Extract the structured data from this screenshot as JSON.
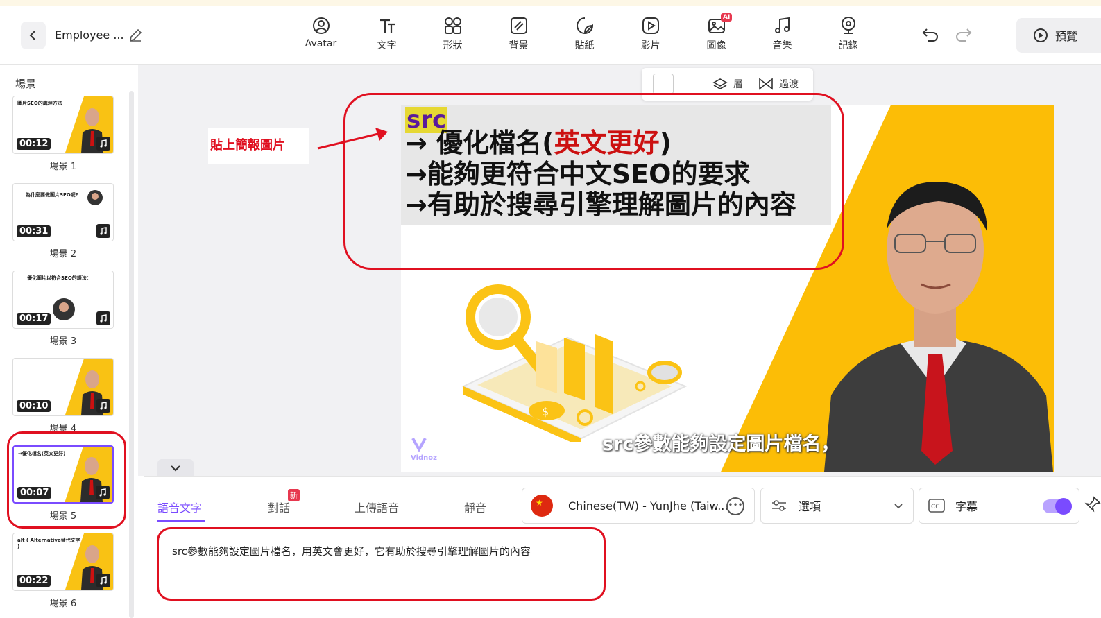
{
  "header": {
    "title": "Employee ...",
    "tools": [
      {
        "label": "Avatar",
        "icon": "avatar-icon"
      },
      {
        "label": "文字",
        "icon": "text-icon"
      },
      {
        "label": "形狀",
        "icon": "shapes-icon"
      },
      {
        "label": "背景",
        "icon": "background-icon"
      },
      {
        "label": "貼紙",
        "icon": "sticker-icon"
      },
      {
        "label": "影片",
        "icon": "video-icon"
      },
      {
        "label": "圖像",
        "icon": "image-icon",
        "badge": "AI"
      },
      {
        "label": "音樂",
        "icon": "music-icon"
      },
      {
        "label": "記錄",
        "icon": "record-icon"
      }
    ],
    "preview_label": "預覽"
  },
  "sidebar": {
    "title": "場景",
    "scenes": [
      {
        "label": "場景 1",
        "time": "00:12",
        "thumb_text": "圖片SEO的處理方法"
      },
      {
        "label": "場景 2",
        "time": "00:31",
        "thumb_text": "為什麼要做圖片SEO呢?"
      },
      {
        "label": "場景 3",
        "time": "00:17",
        "thumb_text": "優化圖片以符合SEO的語法："
      },
      {
        "label": "場景 4",
        "time": "00:10",
        "thumb_text": ""
      },
      {
        "label": "場景 5",
        "time": "00:07",
        "thumb_text": "→優化檔名(英文更好)"
      },
      {
        "label": "場景 6",
        "time": "00:22",
        "thumb_text": "alt ( Alternative替代文字 )"
      }
    ]
  },
  "layer_bar": {
    "layer_label": "層",
    "transition_label": "過渡"
  },
  "slide": {
    "src_label": "src",
    "line1_prefix": "→ 優化檔名(",
    "line1_highlight": "英文更好",
    "line1_suffix": ")",
    "line2": "→能夠更符合中文SEO的要求",
    "line3": "→有助於搜尋引擎理解圖片的內容",
    "caption": "src參數能夠設定圖片檔名，",
    "watermark": "Vidnoz",
    "accent_color": "#fcbd06",
    "highlight_color": "#cc1111"
  },
  "annotation": {
    "text": "貼上簡報圖片"
  },
  "bottom": {
    "tabs": [
      "語音文字",
      "對話",
      "上傳語音",
      "靜音"
    ],
    "new_badge": "新",
    "voice": "Chinese(TW) - YunJhe (Taiw...",
    "options_label": "選項",
    "subtitles_label": "字幕",
    "script": "src參數能夠設定圖片檔名，用英文會更好，它有助於搜尋引擎理解圖片的內容"
  },
  "colors": {
    "brand": "#7a4bff",
    "annotation_red": "#e01020"
  }
}
